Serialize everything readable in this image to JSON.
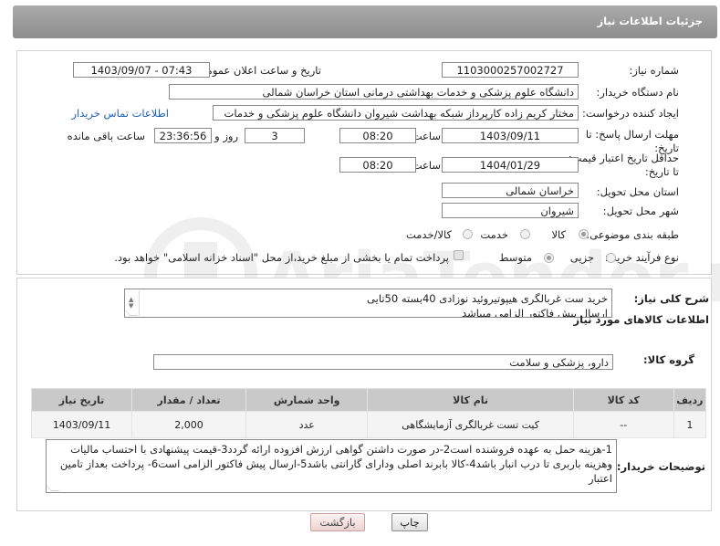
{
  "header": {
    "title": "جزئیات اطلاعات نیاز"
  },
  "form": {
    "need_number_label": "شماره نیاز:",
    "need_number": "1103000257002727",
    "announce_label": "تاریخ و ساعت اعلان عمومی:",
    "announce_value": "1403/09/07 - 07:43",
    "buyer_org_label": "نام دستگاه خریدار:",
    "buyer_org": "دانشگاه علوم پزشکی و خدمات بهداشتی درمانی استان خراسان شمالی",
    "creator_label": "ایجاد کننده درخواست:",
    "creator": "مختار کریم زاده کارپرداز شبکه بهداشت شیروان دانشگاه علوم پزشکی و خدمات",
    "contact_link": "اطلاعات تماس خریدار",
    "deadline_label": "مهلت ارسال پاسخ: تا تاریخ:",
    "deadline_date": "1403/09/11",
    "time_label": "ساعت",
    "deadline_time": "08:20",
    "days_value": "3",
    "days_label": "روز و",
    "remaining_value": "23:36:56",
    "remaining_label": "ساعت باقی مانده",
    "validity_label": "حداقل تاریخ اعتبار قیمت: تا تاریخ:",
    "validity_date": "1404/01/29",
    "validity_time": "08:20",
    "province_label": "استان محل تحویل:",
    "province": "خراسان شمالی",
    "city_label": "شهر محل تحویل:",
    "city": "شیروان",
    "category_label": "طبقه بندی موضوعی:",
    "category_options": [
      "کالا",
      "خدمت",
      "کالا/خدمت"
    ],
    "process_label": "نوع فرآیند خرید :",
    "process_options": [
      "جزیی",
      "متوسط"
    ],
    "payment_text": "پرداخت تمام یا بخشی از مبلغ خرید،از محل \"اسناد خزانه اسلامی\" خواهد بود."
  },
  "details": {
    "description_label": "شرح کلی نیاز:",
    "description_lines": [
      "خرید ست غربالگری هیپوتیروئید نوزادی 40بسته 50تایی",
      "ارسال پیش فاکتور الزامی میباشد"
    ],
    "goods_info_title": "اطلاعات کالاهای مورد نیاز",
    "goods_group_label": "گروه کالا:",
    "goods_group": "دارو، پزشکی و سلامت",
    "table": {
      "headers": [
        "ردیف",
        "کد کالا",
        "نام کالا",
        "واحد شمارش",
        "تعداد / مقدار",
        "تاریخ نیاز"
      ],
      "rows": [
        [
          "1",
          "--",
          "کیت تست غربالگری آزمایشگاهی",
          "عدد",
          "2,000",
          "1403/09/11"
        ]
      ]
    },
    "buyer_notes_label": "توضیحات خریدار:",
    "buyer_notes": "1-هزینه حمل به عهده فروشنده است2-در صورت داشتن گواهی ارزش افزوده ارائه گردد3-قیمت پیشنهادی با احتساب مالیات وهزینه باربری تا درب انبار  باشد4-کالا بابرند اصلی ودارای گارانتی باشد5-ارسال پیش فاکتور الزامی است6- پرداخت بعداز تامین اعتبار"
  },
  "buttons": {
    "print": "چاپ",
    "back": "بازگشت"
  },
  "watermark_text": "AriaTender.net"
}
